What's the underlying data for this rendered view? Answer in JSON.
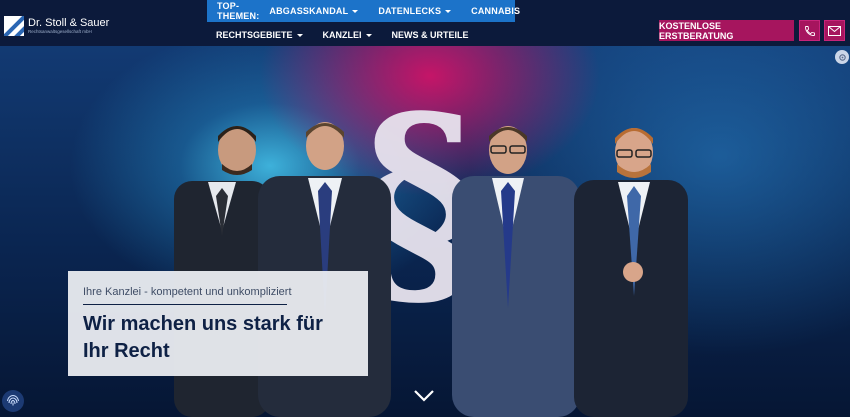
{
  "brand": {
    "name": "Dr. Stoll & Sauer",
    "tagline": "Rechtsanwaltsgesellschaft mbH"
  },
  "topbar": {
    "label": "TOP-THEMEN:",
    "items": [
      {
        "label": "ABGASSKANDAL",
        "dropdown": true
      },
      {
        "label": "DATENLECKS",
        "dropdown": true
      },
      {
        "label": "CANNABIS",
        "dropdown": false
      }
    ]
  },
  "mainnav": {
    "items": [
      {
        "label": "RECHTSGEBIETE",
        "dropdown": true
      },
      {
        "label": "KANZLEI",
        "dropdown": true
      },
      {
        "label": "NEWS & URTEILE",
        "dropdown": false
      }
    ]
  },
  "cta": {
    "label": "KOSTENLOSE ERSTBERATUNG"
  },
  "icons": {
    "phone": "phone-icon",
    "mail": "mail-icon",
    "scroll": "chevron-down-icon",
    "fingerprint": "fingerprint-icon",
    "settings": "settings-icon"
  },
  "hero": {
    "subtitle": "Ihre Kanzlei - kompetent und unkompliziert",
    "title": "Wir machen uns stark für Ihr Recht"
  },
  "colors": {
    "header_bg": "#0c1a3b",
    "topbar_bg": "#1c73c9",
    "accent": "#a6155e",
    "text_dark": "#0e2145"
  }
}
